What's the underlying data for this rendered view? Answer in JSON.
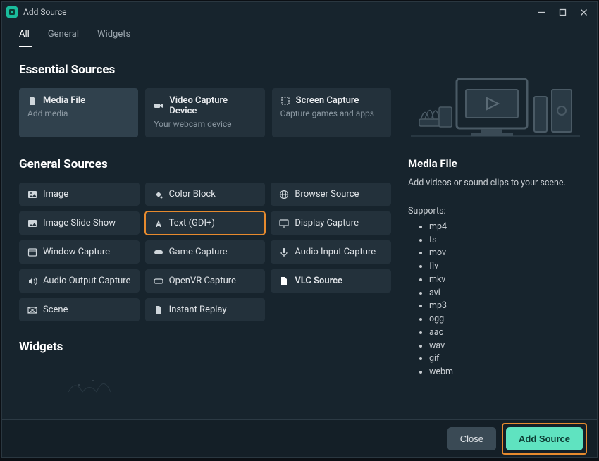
{
  "window": {
    "title": "Add Source"
  },
  "tabs": [
    {
      "label": "All",
      "active": true
    },
    {
      "label": "General",
      "active": false
    },
    {
      "label": "Widgets",
      "active": false
    }
  ],
  "sections": {
    "essential": {
      "heading": "Essential Sources",
      "cards": [
        {
          "title": "Media File",
          "subtitle": "Add media",
          "icon": "file",
          "selected": true
        },
        {
          "title": "Video Capture Device",
          "subtitle": "Your webcam device",
          "icon": "camera",
          "selected": false
        },
        {
          "title": "Screen Capture",
          "subtitle": "Capture games and apps",
          "icon": "crop",
          "selected": false
        }
      ]
    },
    "general": {
      "heading": "General Sources",
      "items": [
        {
          "label": "Image",
          "icon": "image"
        },
        {
          "label": "Color Block",
          "icon": "paint"
        },
        {
          "label": "Browser Source",
          "icon": "globe"
        },
        {
          "label": "Image Slide Show",
          "icon": "image"
        },
        {
          "label": "Text (GDI+)",
          "icon": "text",
          "highlighted": true
        },
        {
          "label": "Display Capture",
          "icon": "monitor"
        },
        {
          "label": "Window Capture",
          "icon": "window"
        },
        {
          "label": "Game Capture",
          "icon": "gamepad"
        },
        {
          "label": "Audio Input Capture",
          "icon": "mic"
        },
        {
          "label": "Audio Output Capture",
          "icon": "speaker"
        },
        {
          "label": "OpenVR Capture",
          "icon": "vr"
        },
        {
          "label": "VLC Source",
          "icon": "file",
          "bold": true
        },
        {
          "label": "Scene",
          "icon": "scene"
        },
        {
          "label": "Instant Replay",
          "icon": "file"
        }
      ]
    },
    "widgets": {
      "heading": "Widgets"
    }
  },
  "sidebar": {
    "title": "Media File",
    "description": "Add videos or sound clips to your scene.",
    "supports_label": "Supports:",
    "formats": [
      "mp4",
      "ts",
      "mov",
      "flv",
      "mkv",
      "avi",
      "mp3",
      "ogg",
      "aac",
      "wav",
      "gif",
      "webm"
    ]
  },
  "footer": {
    "close_label": "Close",
    "add_label": "Add Source"
  }
}
